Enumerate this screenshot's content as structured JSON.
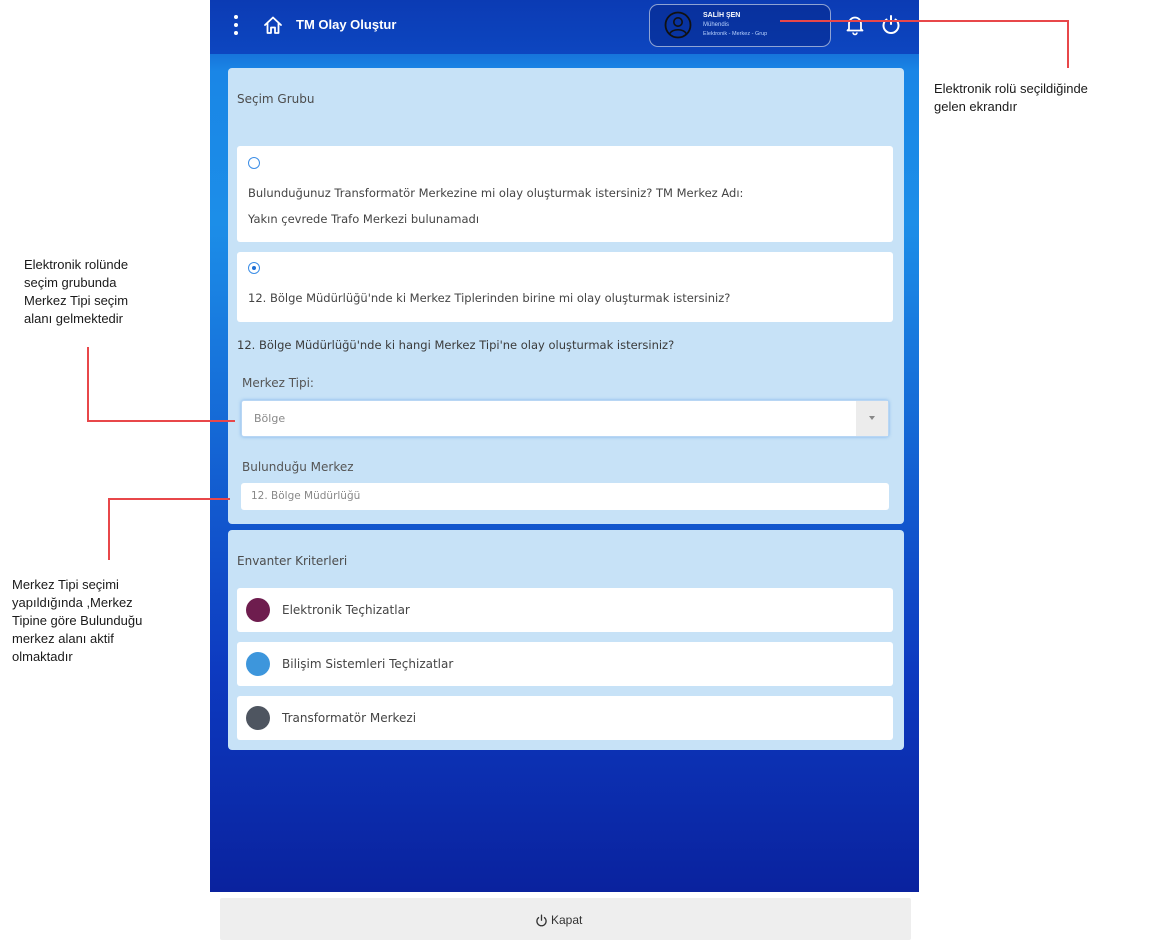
{
  "header": {
    "title": "TM Olay Oluştur",
    "user": {
      "name": "SALİH ŞEN",
      "role": "Mühendis",
      "scope": "Elektronik - Merkez - Grup"
    }
  },
  "selection_group": {
    "title": "Seçim Grubu",
    "options": [
      {
        "checked": false,
        "line1": "Bulunduğunuz Transformatör Merkezine mi olay oluşturmak istersiniz? TM Merkez Adı:",
        "line2": "Yakın çevrede Trafo Merkezi bulunamadı"
      },
      {
        "checked": true,
        "line1": "12. Bölge Müdürlüğü'nde ki Merkez Tiplerinden birine mi olay oluşturmak istersiniz?"
      }
    ],
    "question": "12. Bölge Müdürlüğü'nde ki hangi Merkez Tipi'ne olay oluşturmak istersiniz?",
    "center_type": {
      "label": "Merkez Tipi:",
      "value": "Bölge"
    },
    "located_center": {
      "label": "Bulunduğu Merkez",
      "value": "12. Bölge Müdürlüğü"
    }
  },
  "inventory": {
    "title": "Envanter Kriterleri",
    "items": [
      {
        "label": "Elektronik Teçhizatlar",
        "color": "#6e1d4e"
      },
      {
        "label": "Bilişim Sistemleri Teçhizatlar",
        "color": "#3d96dc"
      },
      {
        "label": "Transformatör Merkezi",
        "color": "#4e5560"
      }
    ]
  },
  "footer": {
    "close_label": "Kapat"
  },
  "annotations": {
    "top_right": [
      "Elektronik rolü seçildiğinde",
      "gelen ekrandır"
    ],
    "left_middle": [
      "Elektronik rolünde",
      "seçim grubunda",
      "Merkez Tipi seçim",
      "alanı gelmektedir"
    ],
    "left_bottom": [
      "Merkez Tipi seçimi",
      "yapıldığında ,Merkez",
      "Tipine göre Bulunduğu",
      "merkez alanı aktif",
      "olmaktadır"
    ]
  },
  "colors": {
    "accent": "#1f6fd4",
    "header": "#0b3bb4",
    "card": "#c7e2f7",
    "annotation_line": "#e8474a"
  }
}
